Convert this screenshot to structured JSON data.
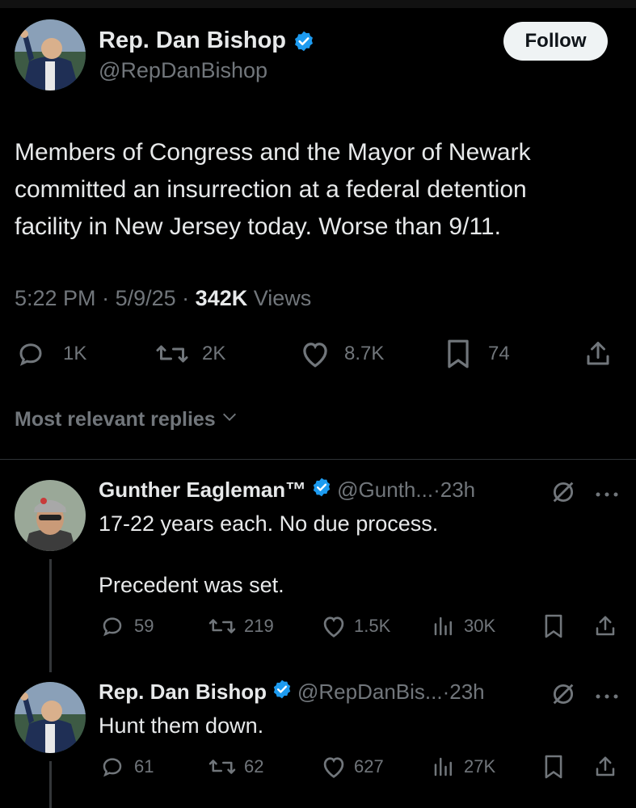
{
  "main_tweet": {
    "author_name": "Rep. Dan Bishop",
    "handle": "@RepDanBishop",
    "follow_label": "Follow",
    "text_lines": [
      "Members of Congress and the Mayor of Newark",
      "committed an insurrection at a federal detention",
      "facility in New Jersey today. Worse than 9/11."
    ],
    "time": "5:22 PM",
    "date": "5/9/25",
    "views_count": "342K",
    "views_label": "Views",
    "replies": "1K",
    "reposts": "2K",
    "likes": "8.7K",
    "bookmarks": "74"
  },
  "replies_sort": {
    "label": "Most relevant replies"
  },
  "replies": [
    {
      "author_name": "Gunther Eagleman™",
      "handle": "@Gunth...",
      "age": "23h",
      "line1": "17-22 years each.  No due process.",
      "line2": "Precedent was set.",
      "replies": "59",
      "reposts": "219",
      "likes": "1.5K",
      "views": "30K"
    },
    {
      "author_name": "Rep. Dan Bishop",
      "handle": "@RepDanBis...",
      "age": "23h",
      "line1": "Hunt them down.",
      "replies": "61",
      "reposts": "62",
      "likes": "627",
      "views": "27K"
    }
  ],
  "colors": {
    "background": "#000000",
    "text": "#e7e9ea",
    "muted": "#71767b",
    "verified": "#1d9bf0",
    "divider": "#2f3336"
  }
}
